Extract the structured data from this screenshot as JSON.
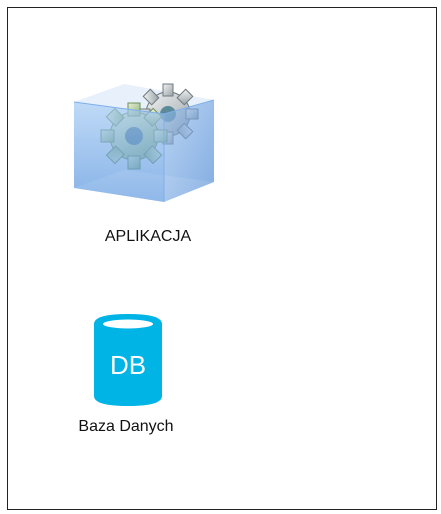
{
  "nodes": {
    "application": {
      "label": "APLIKACJA",
      "icon": "gears-box-icon"
    },
    "database": {
      "label": "Baza Danych",
      "icon_text": "DB",
      "icon": "database-cylinder-icon"
    }
  },
  "colors": {
    "frame_border": "#222222",
    "db_fill": "#00b4e6",
    "box_blue": "#6aa8e8",
    "gear_green": "#b8d7a0"
  }
}
